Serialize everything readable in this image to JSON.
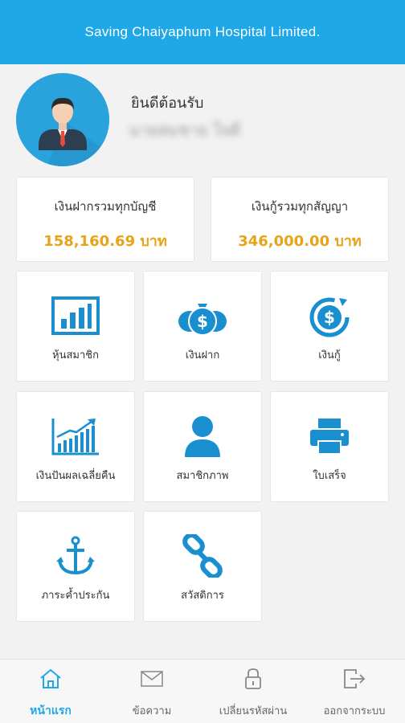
{
  "header": {
    "title": "Saving Chaiyaphum Hospital Limited."
  },
  "profile": {
    "greeting": "ยินดีต้อนรับ",
    "member_name": "นายสมชาย ใจดี",
    "avatar_icon": "user-avatar-icon"
  },
  "summary": {
    "deposit": {
      "label": "เงินฝากรวมทุกบัญชี",
      "value": "158,160.69 บาท"
    },
    "loan": {
      "label": "เงินกู้รวมทุกสัญญา",
      "value": "346,000.00 บาท"
    }
  },
  "menu": [
    {
      "label": "หุ้นสมาชิก",
      "icon": "bar-chart-icon"
    },
    {
      "label": "เงินฝาก",
      "icon": "money-bags-icon"
    },
    {
      "label": "เงินกู้",
      "icon": "loan-dollar-icon"
    },
    {
      "label": "เงินปันผลเฉลี่ยคืน",
      "icon": "growth-chart-icon"
    },
    {
      "label": "สมาชิกภาพ",
      "icon": "person-icon"
    },
    {
      "label": "ใบเสร็จ",
      "icon": "printer-icon"
    },
    {
      "label": "ภาระค้ำประกัน",
      "icon": "anchor-icon"
    },
    {
      "label": "สวัสดิการ",
      "icon": "link-chain-icon"
    }
  ],
  "bottom_nav": [
    {
      "label": "หน้าแรก",
      "icon": "home-icon"
    },
    {
      "label": "ข้อความ",
      "icon": "envelope-icon"
    },
    {
      "label": "เปลี่ยนรหัสผ่าน",
      "icon": "lock-icon"
    },
    {
      "label": "ออกจากระบบ",
      "icon": "logout-icon"
    }
  ],
  "colors": {
    "primary": "#1fa8e8",
    "amount": "#e8a317",
    "background": "#f2f2f2"
  }
}
